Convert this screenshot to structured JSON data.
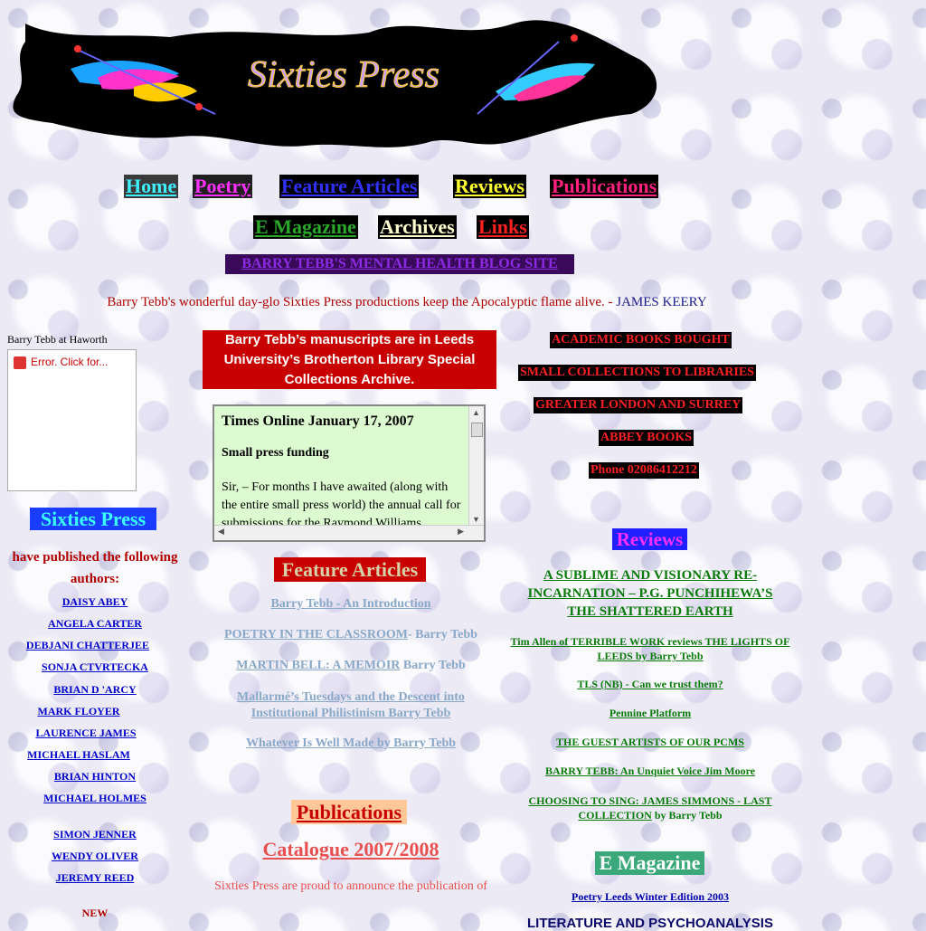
{
  "banner": {
    "title": "Sixties Press"
  },
  "nav": {
    "home": "Home",
    "poetry": "Poetry",
    "feature": "Feature Articles",
    "reviews": "Reviews",
    "publications": "Publications",
    "emagazine": "E Magazine",
    "archives": "Archives",
    "links": "Links"
  },
  "blog_link": "BARRY TEBB'S MENTAL HEALTH BLOG SITE",
  "quote": {
    "text": "Barry Tebb's wonderful day-glo Sixties Press productions keep the Apocalyptic flame alive. - ",
    "author": "JAMES KEERY"
  },
  "left": {
    "haworth_label": "Barry Tebb at Haworth",
    "haworth_error": "Error. Click for...",
    "press_title": "Sixties Press",
    "published_line1": "have published the following",
    "published_line2": "authors:",
    "authors": [
      "DAISY ABEY",
      "ANGELA CARTER",
      "DEBJANI CHATTERJEE",
      "SONJA CTVRTECKA",
      "BRIAN D 'ARCY",
      "MARK FLOYER",
      "LAURENCE JAMES",
      "MICHAEL HASLAM",
      "BRIAN HINTON",
      "MICHAEL HOLMES",
      "SIMON JENNER",
      "WENDY OLIVER",
      "JEREMY REED"
    ],
    "new_label": "NEW"
  },
  "center": {
    "manuscripts": "Barry Tebb’s manuscripts are in Leeds University’s Brotherton Library Special Collections Archive.",
    "times": {
      "heading": "Times Online January 17, 2007",
      "subheading": "Small press funding",
      "body": "Sir, – For months I have awaited (along with the entire small press world) the annual call for submissions for the Raymond Williams"
    },
    "feature_title": "Feature Articles",
    "articles": [
      {
        "link": "Barry Tebb - An Introduction",
        "rest": ""
      },
      {
        "link": "POETRY IN THE CLASSROOM",
        "rest": "- Barry Tebb"
      },
      {
        "link": "MARTIN BELL: A MEMOIR",
        "rest": " Barry Tebb"
      },
      {
        "link": "Mallarmé’s Tuesdays and the Descent into Institutional Philistinism Barry Tebb",
        "rest": ""
      },
      {
        "link": "Whatever Is Well Made by Barry Tebb",
        "rest": ""
      }
    ],
    "publications_title": "Publications",
    "catalogue": "Catalogue 2007/2008",
    "proud": "Sixties Press are proud to announce the publication of"
  },
  "right": {
    "ads": [
      "ACADEMIC BOOKS BOUGHT",
      "SMALL COLLECTIONS TO LIBRARIES",
      "GREATER LONDON AND SURREY",
      "ABBEY BOOKS",
      "Phone 02086412212"
    ],
    "reviews_title": "Reviews",
    "review_main": "A SUBLIME AND VISIONARY RE-INCARNATION – P.G. PUNCHIHEWA’S THE SHATTERED EARTH",
    "review_links": [
      "Tim Allen of TERRIBLE WORK reviews THE LIGHTS OF LEEDS by Barry Tebb",
      "TLS (NB) - Can we trust them?",
      "Pennine Platform",
      "THE GUEST ARTISTS OF OUR PCMS",
      "BARRY TEBB: An Unquiet Voice Jim Moore"
    ],
    "review_choosing": "CHOOSING TO SING: JAMES SIMMONS - LAST COLLECTION",
    "review_choosing_by": " by Barry Tebb",
    "emag_title": "E Magazine",
    "poetry_leeds": "Poetry Leeds Winter Edition 2003",
    "lit_psy": "LITERATURE AND PSYCHOANALYSIS"
  }
}
